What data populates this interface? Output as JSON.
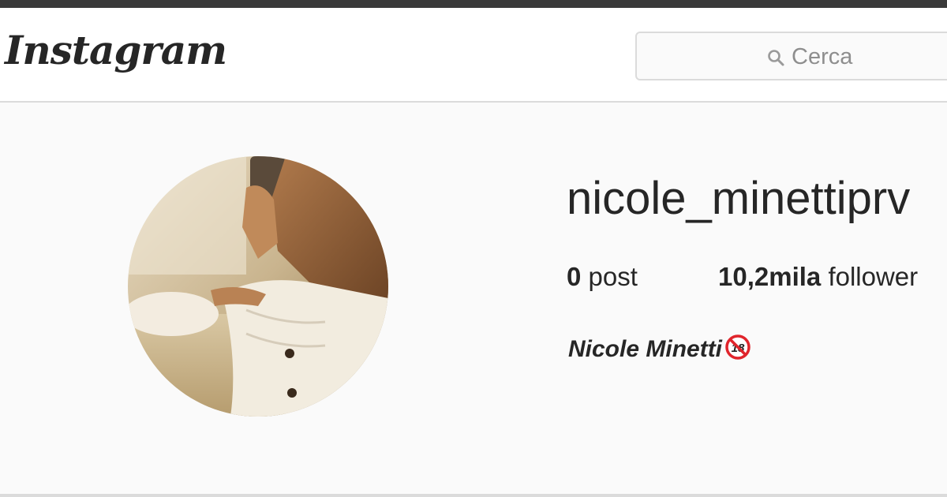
{
  "header": {
    "logo_text": "Instagram",
    "search": {
      "placeholder": "Cerca",
      "icon": "search-icon"
    }
  },
  "profile": {
    "username": "nicole_minettiprv",
    "stats": {
      "posts_count": "0",
      "posts_label": "post",
      "followers_count": "10,2mila",
      "followers_label": "follower"
    },
    "full_name": "Nicole Minetti",
    "emoji": "no-one-under-eighteen",
    "emoji_text": "18"
  },
  "colors": {
    "text": "#262626",
    "muted": "#8e8e8e",
    "border": "#dbdbdb",
    "background": "#fafafa",
    "emoji_red": "#e0242b"
  }
}
